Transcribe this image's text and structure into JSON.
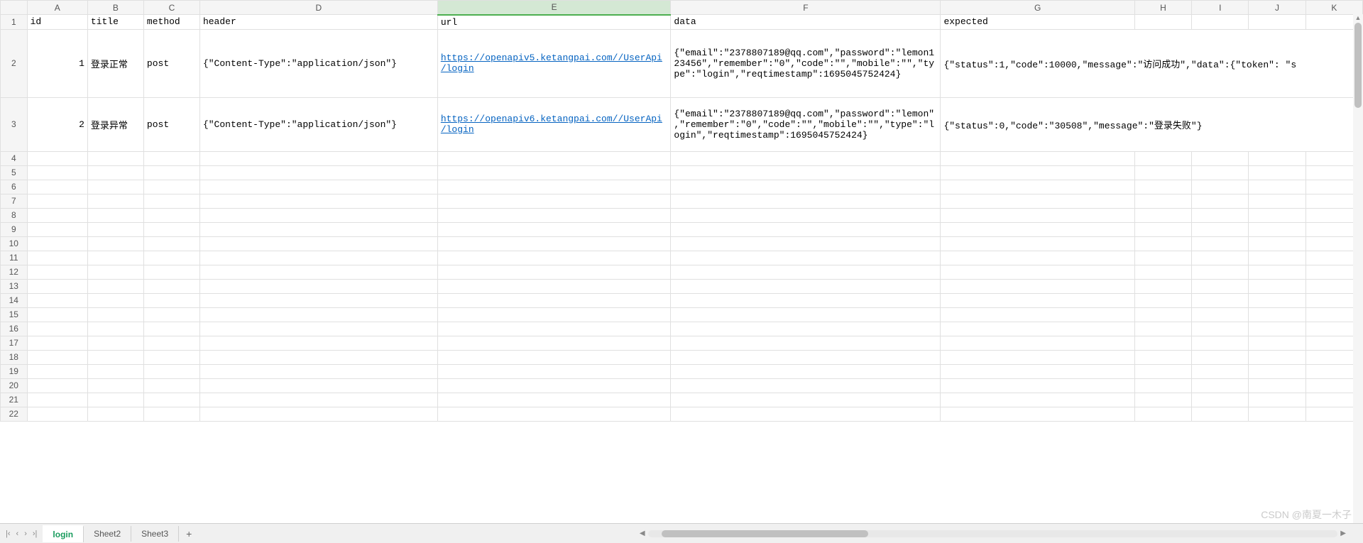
{
  "columns": [
    "A",
    "B",
    "C",
    "D",
    "E",
    "F",
    "G",
    "H",
    "I",
    "J",
    "K"
  ],
  "selected_column": "E",
  "header_row": {
    "A": "id",
    "B": "title",
    "C": "method",
    "D": "header",
    "E": "url",
    "F": "data",
    "G": "expected"
  },
  "rows": [
    {
      "id": "1",
      "title": "登录正常",
      "method": "post",
      "header": "{\"Content-Type\":\"application/json\"}",
      "url": "https://openapiv5.ketangpai.com//UserApi/login",
      "data": "{\"email\":\"2378807189@qq.com\",\"password\":\"lemon123456\",\"remember\":\"0\",\"code\":\"\",\"mobile\":\"\",\"type\":\"login\",\"reqtimestamp\":1695045752424}",
      "expected": "{\"status\":1,\"code\":10000,\"message\":\"访问成功\",\"data\":{\"token\": \"s"
    },
    {
      "id": "2",
      "title": "登录异常",
      "method": "post",
      "header": "{\"Content-Type\":\"application/json\"}",
      "url": "https://openapiv6.ketangpai.com//UserApi/login",
      "data": "{\"email\":\"2378807189@qq.com\",\"password\":\"lemon\",\"remember\":\"0\",\"code\":\"\",\"mobile\":\"\",\"type\":\"login\",\"reqtimestamp\":1695045752424}",
      "expected": "{\"status\":0,\"code\":\"30508\",\"message\":\"登录失败\"}"
    }
  ],
  "empty_row_numbers": [
    "4",
    "5",
    "6",
    "7",
    "8",
    "9",
    "10",
    "11",
    "12",
    "13",
    "14",
    "15",
    "16",
    "17",
    "18",
    "19",
    "20",
    "21",
    "22"
  ],
  "sheets": {
    "active": "login",
    "tabs": [
      "login",
      "Sheet2",
      "Sheet3"
    ]
  },
  "nav": {
    "first": "|‹",
    "prev": "‹",
    "next": "›",
    "last": "›|"
  },
  "add_sheet": "+",
  "watermark": "CSDN @南夏一木子"
}
